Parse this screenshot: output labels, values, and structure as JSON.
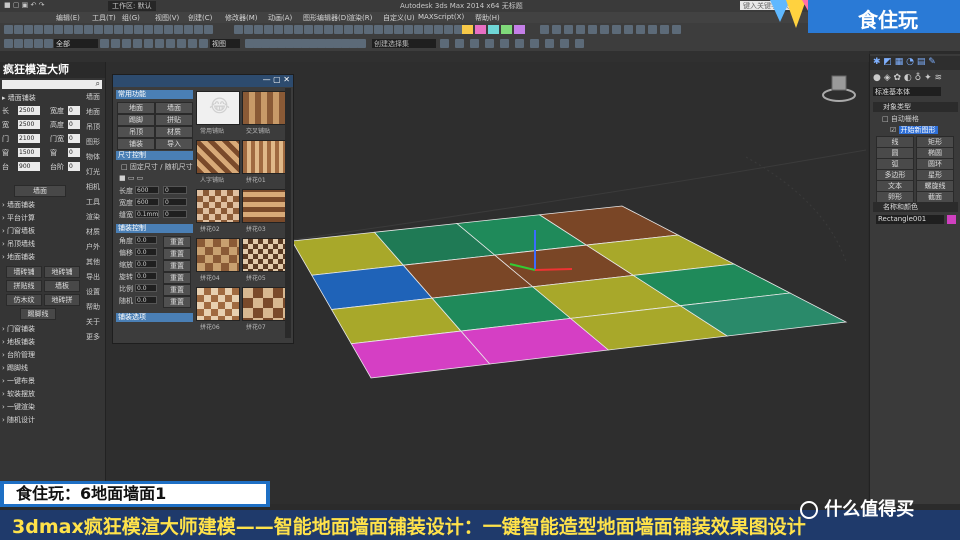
{
  "window": {
    "workspace_label": "工作区: 默认",
    "app_title": "Autodesk 3ds Max 2014 x64    无标题",
    "search_placeholder": "键入关键字或短语"
  },
  "menu": [
    "编辑(E)",
    "工具(T)",
    "组(G)",
    "视图(V)",
    "创建(C)",
    "修改器(M)",
    "动画(A)",
    "图形编辑器(D)",
    "渲染(R)",
    "自定义(U)",
    "MAXScript(X)",
    "帮助(H)"
  ],
  "toolbar": {
    "selection_filter": "全部",
    "view_dropdown": "视图",
    "named_selection": "创建选择集",
    "accent_colors": [
      "#f7c948",
      "#e86fc4",
      "#6fd6d6",
      "#7fd97a",
      "#c47fe8"
    ]
  },
  "left_panel": {
    "title": "疯狂模渲大师",
    "section_header": "墙面铺装",
    "fields": [
      {
        "label": "长",
        "value": "2500",
        "label2": "宽度",
        "value2": "0"
      },
      {
        "label": "宽",
        "value": "2500",
        "label2": "高度",
        "value2": "0"
      },
      {
        "label": "门",
        "value": "2100",
        "label2": "门宽",
        "value2": "0"
      },
      {
        "label": "窗",
        "value": "1500",
        "label2": "窗",
        "value2": "0"
      },
      {
        "label": "台",
        "value": "900",
        "label2": "台阶",
        "value2": "0"
      }
    ],
    "create_button": "墙面",
    "items": [
      "墙面铺装",
      "平台计算",
      "门窗墙板",
      "吊顶墙线",
      "地面铺装",
      "门窗铺装",
      "地板铺装",
      "台阶管理",
      "踢脚线",
      "一键布景",
      "软装摆放",
      "一键渲染",
      "随机设计"
    ],
    "buttons": [
      "墙砖铺",
      "地砖铺",
      "拼贴线",
      "墙板",
      "仿木纹",
      "地砖拼"
    ],
    "single_button": "踢脚线",
    "side_tabs": [
      "墙面",
      "地面",
      "吊顶",
      "图形",
      "物体",
      "灯光",
      "相机",
      "工具",
      "渲染",
      "材质",
      "户外",
      "其他",
      "导出",
      "设置",
      "帮助",
      "关于",
      "更多"
    ]
  },
  "float_window": {
    "section_common": "常用功能",
    "common_buttons": [
      "地面",
      "墙面",
      "踢脚",
      "拼贴",
      "吊顶",
      "材质",
      "铺装",
      "导入"
    ],
    "section_size": "尺寸控制",
    "size_check": "固定尺寸 / 随机尺寸",
    "size_fields": [
      {
        "label": "长度",
        "value": "600"
      },
      {
        "label": "宽度",
        "value": "600"
      },
      {
        "label": "缝宽",
        "value": "0.1mm"
      }
    ],
    "section_style": "铺装控制",
    "style_fields": [
      {
        "label": "角度",
        "value": "0.0",
        "btn": "重置"
      },
      {
        "label": "偏移",
        "value": "0.0",
        "btn": "重置"
      },
      {
        "label": "缩放",
        "value": "0.0",
        "btn": "重置"
      },
      {
        "label": "旋转",
        "value": "0.0",
        "btn": "重置"
      },
      {
        "label": "比例",
        "value": "0.0",
        "btn": "重置"
      },
      {
        "label": "随机",
        "value": "0.0",
        "btn": "重置"
      }
    ],
    "section_bottom": "铺装选项",
    "thumbs": [
      "常用铺贴",
      "交叉铺贴",
      "人字铺贴",
      "拼花01",
      "拼花02",
      "拼花03",
      "拼花04",
      "拼花05",
      "拼花06",
      "拼花07"
    ]
  },
  "right_panel": {
    "dropdown": "标准基本体",
    "rollout_object_type": "对象类型",
    "autogrid": "自动栅格",
    "start_new_shape": "开始新图形",
    "buttons": [
      "线",
      "矩形",
      "圆",
      "椭圆",
      "弧",
      "圆环",
      "多边形",
      "星形",
      "文本",
      "螺旋线",
      "卵形",
      "截面"
    ],
    "rollout_name": "名称和颜色",
    "name_value": "Rectangle001"
  },
  "tiles": {
    "rows": [
      [
        "#a8a82a",
        "#1f7a55",
        "#1f8a5a",
        "#7a4626"
      ],
      [
        "#1f63b8",
        "#7a4626",
        "#7a4626",
        "#a8a82a"
      ],
      [
        "#a8a82a",
        "#1f8a5a",
        "#a8a82a",
        "#1f8a5a"
      ],
      [
        "#d53fc4",
        "#d53fc4",
        "#a8a82a",
        "#2a8a6a"
      ]
    ]
  },
  "captions": {
    "episode": "食住玩：6地面墙面1",
    "subtitle": "3dmax疯狂模渲大师建模——智能地面墙面铺装设计：一键智能造型地面墙面铺装效果图设计",
    "brand": "食住玩",
    "watermark": "什么值得买"
  }
}
